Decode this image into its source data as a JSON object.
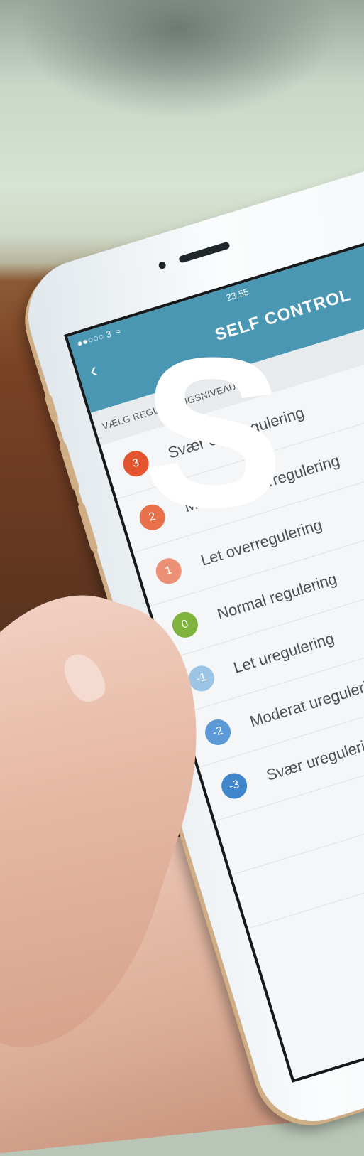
{
  "overlay": {
    "letter": "S"
  },
  "app": {
    "status": {
      "carrier": "●●○○○ 3",
      "time": "23.55"
    },
    "title": "SELF CONTROL",
    "subheader": "VÆLG REGULERINGSNIVEAU",
    "items": [
      {
        "value": "3",
        "label": "Svær overregulering",
        "color": "#e4552f"
      },
      {
        "value": "2",
        "label": "Moderat overregulering",
        "color": "#e8714c"
      },
      {
        "value": "1",
        "label": "Let overregulering",
        "color": "#ec9176"
      },
      {
        "value": "0",
        "label": "Normal regulering",
        "color": "#7fb33d"
      },
      {
        "value": "-1",
        "label": "Let uregulering",
        "color": "#9cc4e4"
      },
      {
        "value": "-2",
        "label": "Moderat uregulering",
        "color": "#5b9ad6"
      },
      {
        "value": "-3",
        "label": "Svær uregulering",
        "color": "#3f86cc"
      }
    ],
    "cta_color": "#8ab73e"
  }
}
